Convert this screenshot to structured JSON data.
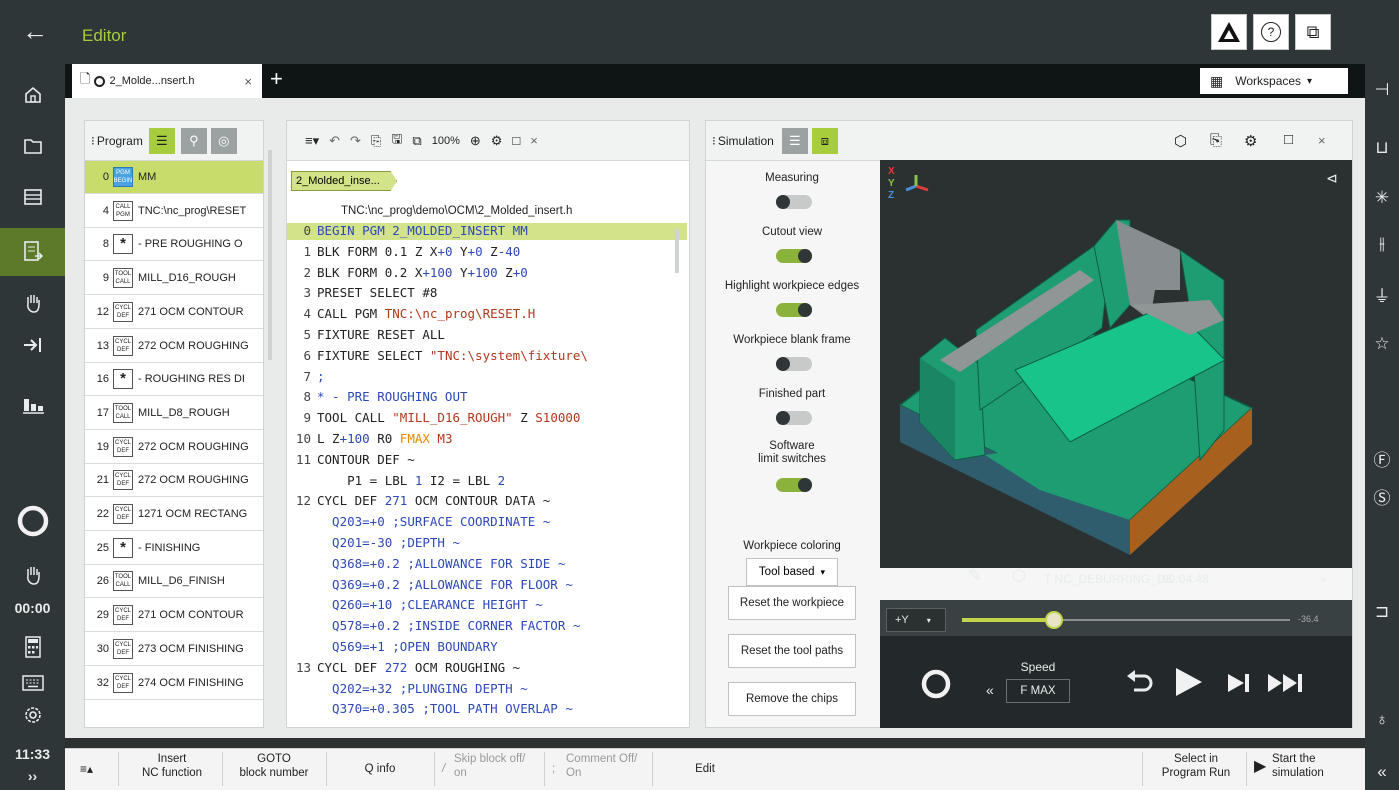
{
  "app": {
    "title": "Editor",
    "back": "←"
  },
  "topbar": {
    "help": "?",
    "windows": "⧉"
  },
  "tab": {
    "label": "2_Molde...nsert.h",
    "close": "×",
    "add": "+"
  },
  "workspaces": {
    "label": "Workspaces",
    "caret": "▾"
  },
  "left_clock": {
    "t1": "00:00",
    "t2": "11:33",
    "expand": "››"
  },
  "program_panel": {
    "title": "Program",
    "rows": [
      {
        "num": "0",
        "tag": [
          "PGM",
          "BEGIN"
        ],
        "text": "MM",
        "selected": true,
        "tagstyle": "blue"
      },
      {
        "num": "4",
        "tag": [
          "CALL",
          "PGM"
        ],
        "text": "TNC:\\nc_prog\\RESET"
      },
      {
        "num": "8",
        "tag": [
          "*"
        ],
        "text": "- PRE ROUGHING O",
        "tagstyle": "star"
      },
      {
        "num": "9",
        "tag": [
          "TOOL",
          "CALL"
        ],
        "text": "MILL_D16_ROUGH"
      },
      {
        "num": "12",
        "tag": [
          "CYCL",
          "DEF"
        ],
        "text": "271 OCM CONTOUR"
      },
      {
        "num": "13",
        "tag": [
          "CYCL",
          "DEF"
        ],
        "text": "272 OCM ROUGHING"
      },
      {
        "num": "16",
        "tag": [
          "*"
        ],
        "text": "- ROUGHING RES DI",
        "tagstyle": "star"
      },
      {
        "num": "17",
        "tag": [
          "TOOL",
          "CALL"
        ],
        "text": "MILL_D8_ROUGH"
      },
      {
        "num": "19",
        "tag": [
          "CYCL",
          "DEF"
        ],
        "text": "272 OCM ROUGHING"
      },
      {
        "num": "21",
        "tag": [
          "CYCL",
          "DEF"
        ],
        "text": "272 OCM ROUGHING"
      },
      {
        "num": "22",
        "tag": [
          "CYCL",
          "DEF"
        ],
        "text": "1271 OCM RECTANG"
      },
      {
        "num": "25",
        "tag": [
          "*"
        ],
        "text": "- FINISHING",
        "tagstyle": "star"
      },
      {
        "num": "26",
        "tag": [
          "TOOL",
          "CALL"
        ],
        "text": "MILL_D6_FINISH"
      },
      {
        "num": "29",
        "tag": [
          "CYCL",
          "DEF"
        ],
        "text": "271 OCM CONTOUR"
      },
      {
        "num": "30",
        "tag": [
          "CYCL",
          "DEF"
        ],
        "text": "273 OCM FINISHING"
      },
      {
        "num": "32",
        "tag": [
          "CYCL",
          "DEF"
        ],
        "text": "274 OCM FINISHING"
      }
    ]
  },
  "editor": {
    "zoom": "100%",
    "breadcrumb": "2_Molded_inse...",
    "path": "TNC:\\nc_prog\\demo\\OCM\\2_Molded_insert.h",
    "lines": [
      {
        "n": "0",
        "hl": true,
        "parts": [
          [
            "BEGIN PGM 2_MOLDED_INSERT MM",
            "bl"
          ]
        ]
      },
      {
        "n": "1",
        "parts": [
          [
            "BLK FORM 0.1 Z X",
            "kw"
          ],
          [
            "+0",
            "bl"
          ],
          [
            " Y",
            "kw"
          ],
          [
            "+0",
            "bl"
          ],
          [
            " Z",
            "kw"
          ],
          [
            "-40",
            "bl"
          ]
        ]
      },
      {
        "n": "2",
        "parts": [
          [
            "BLK FORM 0.2 X",
            "kw"
          ],
          [
            "+100",
            "bl"
          ],
          [
            " Y",
            "kw"
          ],
          [
            "+100",
            "bl"
          ],
          [
            " Z",
            "kw"
          ],
          [
            "+0",
            "bl"
          ]
        ]
      },
      {
        "n": "3",
        "parts": [
          [
            "PRESET SELECT #8",
            "kw"
          ]
        ]
      },
      {
        "n": "4",
        "parts": [
          [
            "CALL PGM ",
            "kw"
          ],
          [
            "TNC:\\nc_prog\\RESET.H",
            "rd"
          ]
        ]
      },
      {
        "n": "5",
        "parts": [
          [
            "FIXTURE RESET ALL",
            "kw"
          ]
        ]
      },
      {
        "n": "6",
        "parts": [
          [
            "FIXTURE SELECT ",
            "kw"
          ],
          [
            "\"TNC:\\system\\fixture\\",
            "rd"
          ]
        ]
      },
      {
        "n": "7",
        "parts": [
          [
            ";",
            "bl"
          ]
        ]
      },
      {
        "n": "8",
        "parts": [
          [
            "* - PRE ROUGHING OUT",
            "bl"
          ]
        ]
      },
      {
        "n": "9",
        "parts": [
          [
            "TOOL CALL ",
            "kw"
          ],
          [
            "\"MILL_D16_ROUGH\"",
            "rd"
          ],
          [
            " Z ",
            "kw"
          ],
          [
            "S10000",
            "rd"
          ]
        ]
      },
      {
        "n": "10",
        "parts": [
          [
            "L Z",
            "kw"
          ],
          [
            "+100",
            "bl"
          ],
          [
            " R0 ",
            "kw"
          ],
          [
            "FMAX",
            "or"
          ],
          [
            " M3",
            "rd"
          ]
        ]
      },
      {
        "n": "11",
        "parts": [
          [
            "CONTOUR DEF ~",
            "kw"
          ]
        ]
      },
      {
        "n": "",
        "parts": [
          [
            "    P1 = LBL ",
            "kw"
          ],
          [
            "1",
            "bl"
          ],
          [
            " I2 = LBL ",
            "kw"
          ],
          [
            "2",
            "bl"
          ]
        ]
      },
      {
        "n": "12",
        "parts": [
          [
            "CYCL DEF ",
            "kw"
          ],
          [
            "271",
            "bl"
          ],
          [
            " OCM CONTOUR DATA ~",
            "kw"
          ]
        ]
      },
      {
        "n": "",
        "parts": [
          [
            "  Q203=+0 ",
            "bl"
          ],
          [
            ";SURFACE COORDINATE ~",
            "bl"
          ]
        ]
      },
      {
        "n": "",
        "parts": [
          [
            "  Q201=-30 ",
            "bl"
          ],
          [
            ";DEPTH ~",
            "bl"
          ]
        ]
      },
      {
        "n": "",
        "parts": [
          [
            "  Q368=+0.2 ",
            "bl"
          ],
          [
            ";ALLOWANCE FOR SIDE ~",
            "bl"
          ]
        ]
      },
      {
        "n": "",
        "parts": [
          [
            "  Q369=+0.2 ",
            "bl"
          ],
          [
            ";ALLOWANCE FOR FLOOR ~",
            "bl"
          ]
        ]
      },
      {
        "n": "",
        "parts": [
          [
            "  Q260=+10 ",
            "bl"
          ],
          [
            ";CLEARANCE HEIGHT ~",
            "bl"
          ]
        ]
      },
      {
        "n": "",
        "parts": [
          [
            "  Q578=+0.2 ",
            "bl"
          ],
          [
            ";INSIDE CORNER FACTOR ~",
            "bl"
          ]
        ]
      },
      {
        "n": "",
        "parts": [
          [
            "  Q569=+1 ",
            "bl"
          ],
          [
            ";OPEN BOUNDARY",
            "bl"
          ]
        ]
      },
      {
        "n": "13",
        "parts": [
          [
            "CYCL DEF ",
            "kw"
          ],
          [
            "272",
            "bl"
          ],
          [
            " OCM ROUGHING ~",
            "kw"
          ]
        ]
      },
      {
        "n": "",
        "parts": [
          [
            "  Q202=+32 ",
            "bl"
          ],
          [
            ";PLUNGING DEPTH ~",
            "bl"
          ]
        ]
      },
      {
        "n": "",
        "parts": [
          [
            "  Q370=+0.305 ",
            "bl"
          ],
          [
            ";TOOL PATH OVERLAP ~",
            "bl"
          ]
        ]
      }
    ]
  },
  "simulation": {
    "title": "Simulation",
    "controls": [
      {
        "label": "Measuring",
        "on": false
      },
      {
        "label": "Cutout view",
        "on": true
      },
      {
        "label": "Highlight workpiece edges",
        "on": true
      },
      {
        "label": "Workpiece blank frame",
        "on": false
      },
      {
        "label": "Finished part",
        "on": false
      },
      {
        "label": "Software\nlimit switches",
        "on": true
      }
    ],
    "coloring_label": "Workpiece coloring",
    "coloring_value": "Tool based",
    "buttons": [
      "Reset the workpiece",
      "Reset the tool paths",
      "Remove the chips"
    ],
    "axis": {
      "x": "X",
      "y": "Y",
      "z": "Z"
    },
    "tool_info": "T NC_DEBURRING_D6",
    "time": "00:04:48",
    "view_select": "+Y",
    "slider_end": "-36.4",
    "slider_level": 0.28,
    "speed_label": "Speed",
    "speed_value": "F MAX"
  },
  "bottom": {
    "insert": "Insert\nNC function",
    "goto": "GOTO\nblock number",
    "qinfo": "Q info",
    "skip": "Skip block off/\non",
    "comment": "Comment Off/\nOn",
    "edit": "Edit",
    "select": "Select in\nProgram Run",
    "start": "Start the\nsimulation"
  },
  "colors": {
    "accent": "#a7cd3c",
    "toggle_on": "#8bb23a",
    "workpiece_green": "#1f9d72",
    "workpiece_brown": "#a8601e"
  }
}
